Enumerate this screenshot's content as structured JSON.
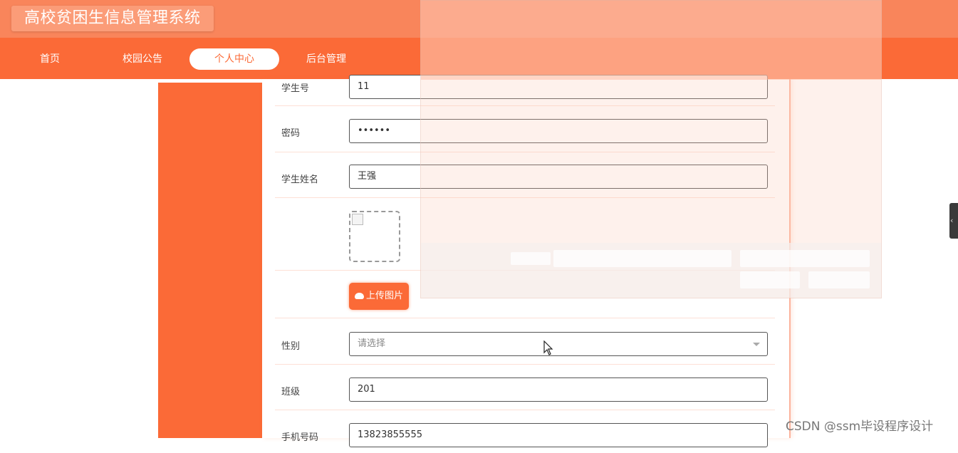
{
  "app": {
    "title": "高校贫困生信息管理系统"
  },
  "nav": {
    "items": [
      {
        "label": "首页"
      },
      {
        "label": "校园公告"
      },
      {
        "label": "个人中心",
        "active": true
      },
      {
        "label": "后台管理"
      }
    ]
  },
  "form": {
    "student_id": {
      "label": "学生号",
      "value": "11"
    },
    "password": {
      "label": "密码",
      "value": "••••••"
    },
    "student_name": {
      "label": "学生姓名",
      "value": "王强"
    },
    "photo": {
      "upload_label": "上传图片"
    },
    "gender": {
      "label": "性别",
      "placeholder": "请选择"
    },
    "class": {
      "label": "班级",
      "value": "201"
    },
    "phone": {
      "label": "手机号码",
      "value": "13823855555"
    }
  },
  "watermark": "CSDN @ssm毕设程序设计",
  "colors": {
    "primary": "#fb6a37",
    "title_bar": "#f9855b",
    "accent_light": "#fb9c78"
  },
  "icons": {
    "upload": "cloud-upload-icon",
    "dropdown": "chevron-down-icon",
    "side_tab": "chevron-left-icon"
  }
}
